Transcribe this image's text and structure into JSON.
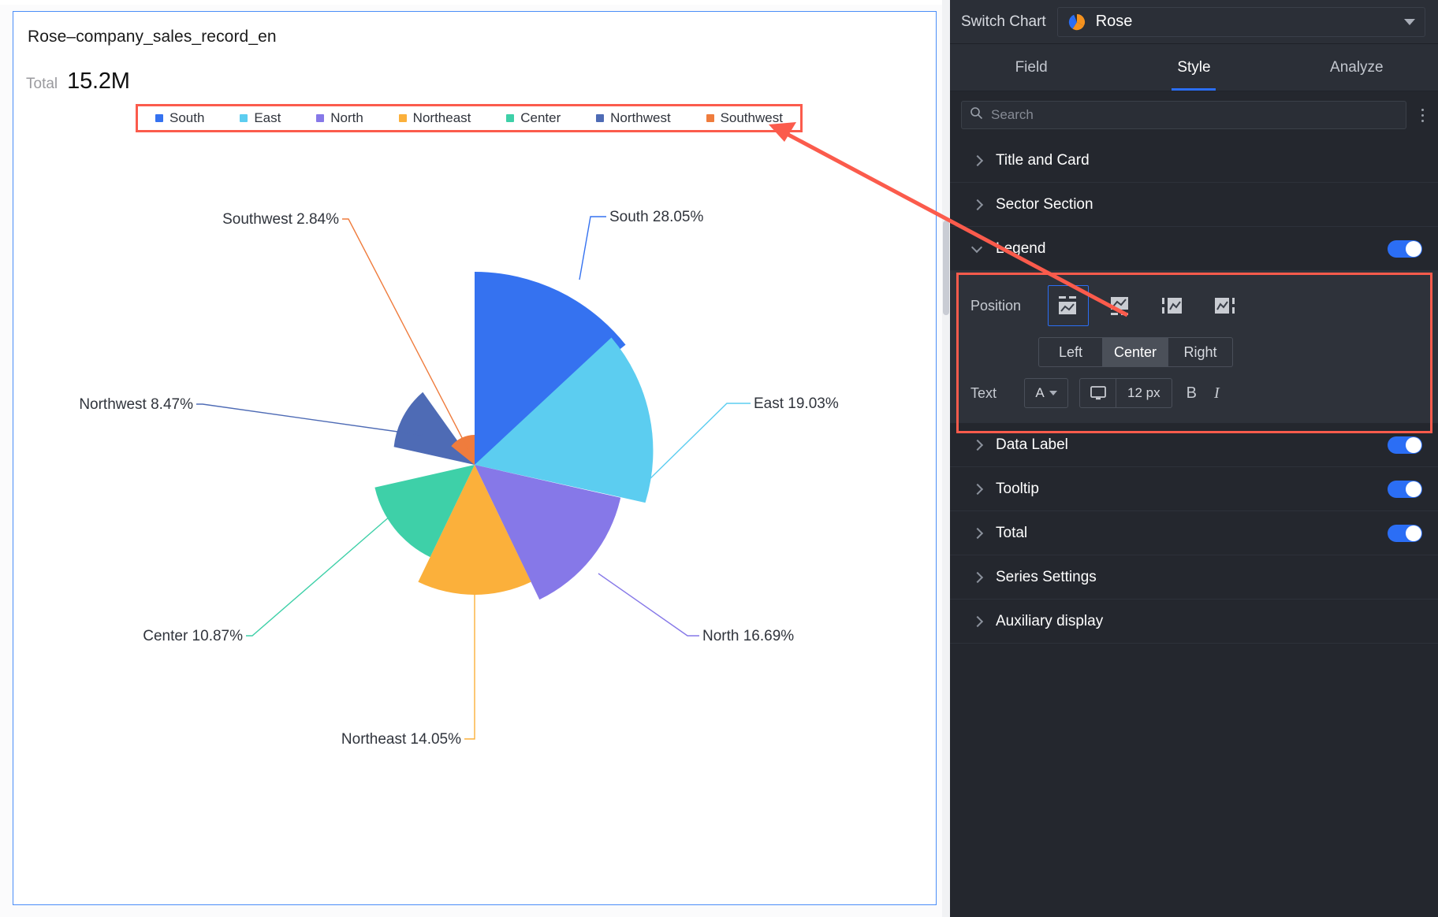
{
  "chart_card": {
    "title": "Rose–company_sales_record_en",
    "total_label": "Total",
    "total_value": "15.2M"
  },
  "chart_data": {
    "type": "pie",
    "variant": "rose",
    "title": "Rose–company_sales_record_en",
    "total": "15.2M",
    "legend_position": "top-center",
    "categories": [
      "South",
      "East",
      "North",
      "Northeast",
      "Center",
      "Northwest",
      "Southwest"
    ],
    "values": [
      28.05,
      19.03,
      16.69,
      14.05,
      10.87,
      8.47,
      2.84
    ],
    "unit": "%",
    "colors": [
      "#3572f0",
      "#5ccdf0",
      "#8678e8",
      "#fbb03b",
      "#3ed0a8",
      "#4e6bb5",
      "#ef7c3d"
    ],
    "data_labels": [
      "South 28.05%",
      "East 19.03%",
      "North 16.69%",
      "Northeast 14.05%",
      "Center 10.87%",
      "Northwest 8.47%",
      "Southwest 2.84%"
    ],
    "legend": [
      {
        "label": "South",
        "color": "#3572f0"
      },
      {
        "label": "East",
        "color": "#5ccdf0"
      },
      {
        "label": "North",
        "color": "#8678e8"
      },
      {
        "label": "Northeast",
        "color": "#fbb03b"
      },
      {
        "label": "Center",
        "color": "#3ed0a8"
      },
      {
        "label": "Northwest",
        "color": "#4e6bb5"
      },
      {
        "label": "Southwest",
        "color": "#ef7c3d"
      }
    ]
  },
  "panel": {
    "switch_chart_label": "Switch Chart",
    "chart_type": "Rose",
    "chart_type_icon": "rose-chart-icon",
    "tabs": [
      {
        "label": "Field",
        "active": false
      },
      {
        "label": "Style",
        "active": true
      },
      {
        "label": "Analyze",
        "active": false
      }
    ],
    "search_placeholder": "Search",
    "search_value": "",
    "sections": [
      {
        "label": "Title and Card",
        "expanded": false,
        "toggle": null
      },
      {
        "label": "Sector Section",
        "expanded": false,
        "toggle": null
      },
      {
        "label": "Legend",
        "expanded": true,
        "toggle": true
      },
      {
        "label": "Data Label",
        "expanded": false,
        "toggle": true
      },
      {
        "label": "Tooltip",
        "expanded": false,
        "toggle": true
      },
      {
        "label": "Total",
        "expanded": false,
        "toggle": true
      },
      {
        "label": "Series Settings",
        "expanded": false,
        "toggle": null
      },
      {
        "label": "Auxiliary display",
        "expanded": false,
        "toggle": null
      }
    ],
    "legend_settings": {
      "position_label": "Position",
      "position_options": [
        {
          "name": "legend-top-icon",
          "selected": true
        },
        {
          "name": "legend-bottom-icon",
          "selected": false
        },
        {
          "name": "legend-left-icon",
          "selected": false
        },
        {
          "name": "legend-right-icon",
          "selected": false
        }
      ],
      "align_options": [
        {
          "label": "Left",
          "active": false
        },
        {
          "label": "Center",
          "active": true
        },
        {
          "label": "Right",
          "active": false
        }
      ],
      "text_label": "Text",
      "font_value": "A",
      "font_size": "12 px",
      "bold_label": "B",
      "italic_label": "I"
    }
  },
  "annotations": {
    "accent_color": "#fb5b4c"
  }
}
